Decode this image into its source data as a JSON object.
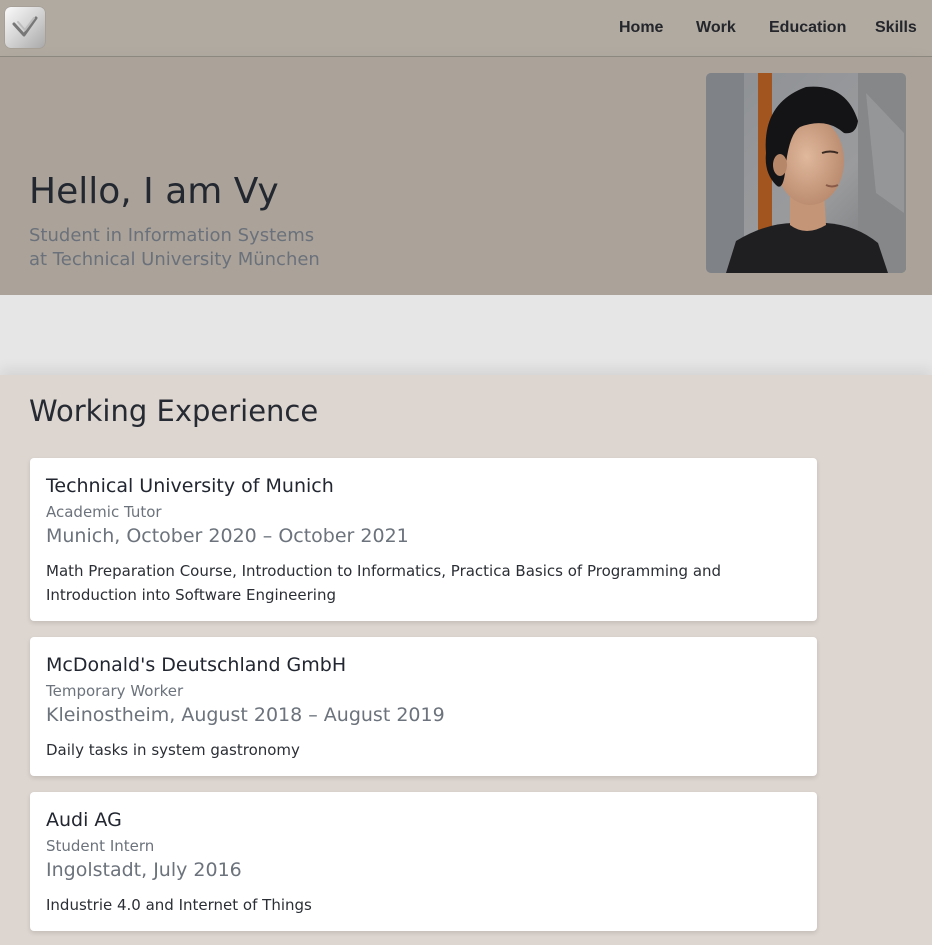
{
  "nav": {
    "logo_name": "site-logo",
    "links": [
      "Home",
      "Work",
      "Education",
      "Skills"
    ]
  },
  "hero": {
    "title": "Hello, I am Vy",
    "subtitle_line1": "Student in Information Systems",
    "subtitle_line2": "at Technical University München"
  },
  "work": {
    "title": "Working Experience",
    "jobs": [
      {
        "company": "Technical University of Munich",
        "role": "Academic Tutor",
        "location": "Munich, October 2020 – October 2021",
        "description": "Math Preparation Course, Introduction to Informatics, Practica Basics of Programming and Introduction into Software Engineering"
      },
      {
        "company": "McDonald's Deutschland GmbH",
        "role": "Temporary Worker",
        "location": "Kleinostheim, August 2018 – August 2019",
        "description": "Daily tasks in system gastronomy"
      },
      {
        "company": "Audi AG",
        "role": "Student Intern",
        "location": "Ingolstadt, July 2016",
        "description": "Industrie 4.0 and Internet of Things"
      }
    ]
  },
  "colors": {
    "navbar": "#b0aaa1",
    "hero": "#aba39a",
    "section_bg": "#ddd5cf",
    "card_bg": "#ffffff",
    "muted_text": "#6c737c"
  }
}
